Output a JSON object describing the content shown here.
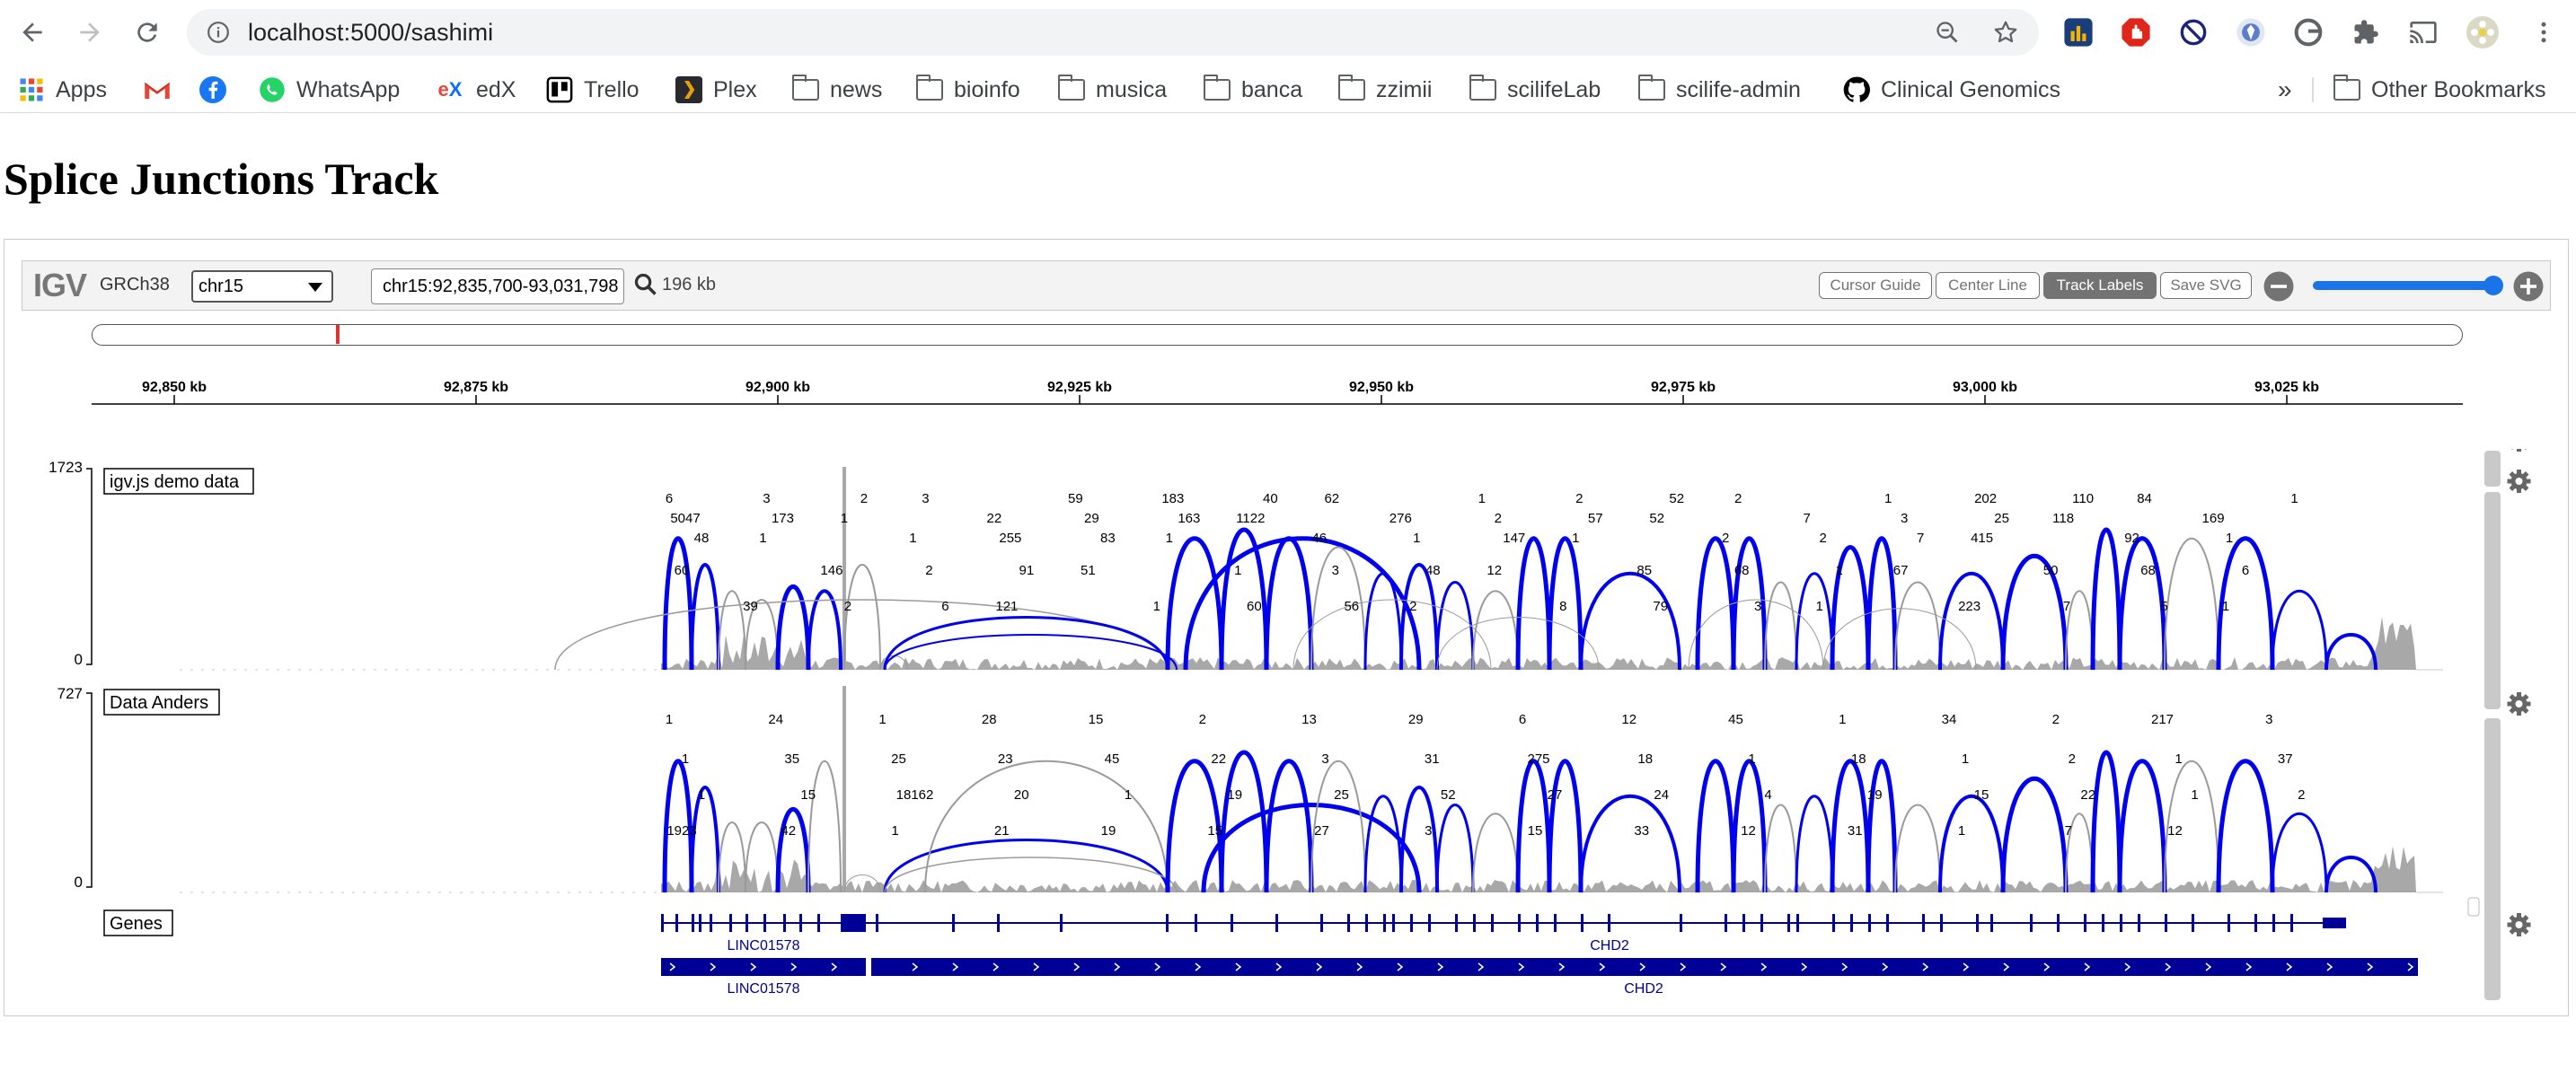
{
  "browser": {
    "url": "localhost:5000/sashimi",
    "bookmarks": [
      "Apps",
      "",
      "",
      "WhatsApp",
      "edX",
      "Trello",
      "Plex",
      "news",
      "bioinfo",
      "musica",
      "banca",
      "zzimii",
      "scilifeLab",
      "scilife-admin",
      "Clinical Genomics"
    ],
    "overflow_label": "»",
    "other_bookmarks": "Other Bookmarks"
  },
  "page": {
    "title": "Splice Junctions Track"
  },
  "igv": {
    "logo": "IGV",
    "genome": "GRCh38",
    "chromosome": "chr15",
    "locus": "chr15:92,835,700-93,031,798",
    "window_size": "196 kb",
    "buttons": {
      "cursor_guide": "Cursor Guide",
      "center_line": "Center Line",
      "track_labels": "Track Labels",
      "save_svg": "Save SVG"
    },
    "ruler_ticks": [
      "92,850 kb",
      "92,875 kb",
      "92,900 kb",
      "92,925 kb",
      "92,950 kb",
      "92,975 kb",
      "93,000 kb",
      "93,025 kb"
    ],
    "tracks": [
      {
        "name": "igv.js demo data",
        "max": "1723",
        "min": "0",
        "labels": [
          "6",
          "5047",
          "48",
          "60",
          "39",
          "3",
          "173",
          "1",
          "146",
          "2",
          "2",
          "1",
          "1",
          "2",
          "6",
          "3",
          "22",
          "255",
          "91",
          "121",
          "59",
          "29",
          "83",
          "51",
          "1",
          "183",
          "163",
          "1",
          "1",
          "60",
          "40",
          "1122",
          "46",
          "3",
          "56",
          "62",
          "276",
          "1",
          "48",
          "2",
          "1",
          "2",
          "147",
          "12",
          "8",
          "2",
          "57",
          "1",
          "85",
          "79",
          "52",
          "52",
          "2",
          "68",
          "3",
          "2",
          "7",
          "2",
          "1",
          "1",
          "1",
          "3",
          "7",
          "67",
          "223",
          "202",
          "25",
          "415",
          "50",
          "7",
          "110",
          "118",
          "92",
          "68",
          "5",
          "84",
          "169",
          "1",
          "6",
          "1",
          "1"
        ]
      },
      {
        "name": "Data Anders",
        "max": "727",
        "min": "0",
        "labels": [
          "1",
          "1",
          "1",
          "1923",
          "24",
          "35",
          "15",
          "42",
          "1",
          "25",
          "18162",
          "1",
          "28",
          "23",
          "20",
          "21",
          "15",
          "45",
          "1",
          "19",
          "2",
          "22",
          "19",
          "15",
          "13",
          "3",
          "25",
          "27",
          "29",
          "31",
          "52",
          "3",
          "6",
          "275",
          "27",
          "15",
          "12",
          "18",
          "24",
          "33",
          "45",
          "1",
          "4",
          "12",
          "1",
          "18",
          "19",
          "31",
          "34",
          "1",
          "15",
          "1",
          "2",
          "2",
          "22",
          "7",
          "217",
          "1",
          "1",
          "12",
          "3",
          "37",
          "2"
        ]
      },
      {
        "name": "Genes",
        "genes": [
          "LINC01578",
          "CHD2",
          "LINC01578",
          "CHD2"
        ]
      }
    ]
  },
  "colors": {
    "junction_primary": "#0000ee",
    "junction_secondary": "#9a9a9a",
    "gene": "#000096",
    "zoom": "#1a73e8"
  }
}
